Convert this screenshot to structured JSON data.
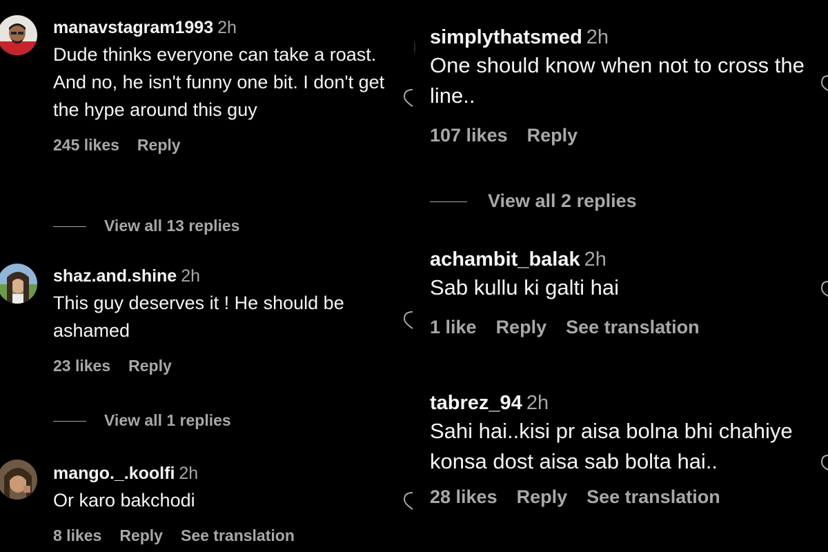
{
  "left_comments": [
    {
      "username": "manavstagram1993",
      "time": "2h",
      "text": "Dude thinks everyone can take a roast. And no, he isn't funny one bit. I don't get the hype around this guy",
      "likes": "245 likes",
      "reply": "Reply",
      "view_replies": "View all 13 replies"
    },
    {
      "username": "shaz.and.shine",
      "time": "2h",
      "text": "This guy deserves it ! He should be ashamed",
      "likes": "23 likes",
      "reply": "Reply",
      "view_replies": "View all 1 replies"
    },
    {
      "username": "mango._.koolfi",
      "time": "2h",
      "text": "Or karo bakchodi",
      "likes": "8 likes",
      "reply": "Reply",
      "translation": "See translation"
    }
  ],
  "right_comments": [
    {
      "username": "simplythatsmed",
      "time": "2h",
      "text": "One should know when not to cross the line..",
      "likes": "107 likes",
      "reply": "Reply",
      "view_replies": "View all 2 replies"
    },
    {
      "username": "achambit_balak",
      "time": "2h",
      "text": "Sab kullu ki galti hai",
      "likes": "1 like",
      "reply": "Reply",
      "translation": "See translation"
    },
    {
      "username": "tabrez_94",
      "time": "2h",
      "text": "Sahi hai..kisi pr aisa bolna bhi chahiye konsa dost aisa sab bolta hai..",
      "likes": "28 likes",
      "reply": "Reply",
      "translation": "See translation"
    }
  ]
}
